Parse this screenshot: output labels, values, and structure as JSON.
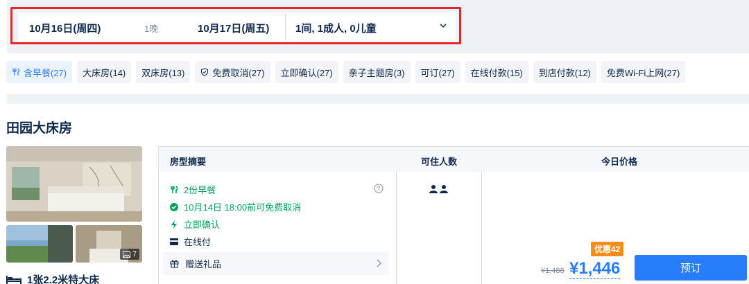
{
  "search": {
    "checkin": "10月16日(周四)",
    "nights": "1晚",
    "checkout": "10月17日(周五)",
    "guests": "1间, 1成人, 0儿童"
  },
  "filters": [
    {
      "label": "含早餐(27)",
      "icon": "utensils-icon",
      "active": true
    },
    {
      "label": "大床房(14)"
    },
    {
      "label": "双床房(13)"
    },
    {
      "label": "免费取消(27)",
      "icon": "shield-check-icon"
    },
    {
      "label": "立即确认(27)"
    },
    {
      "label": "亲子主题房(3)"
    },
    {
      "label": "可订(27)"
    },
    {
      "label": "在线付款(15)"
    },
    {
      "label": "到店付款(12)"
    },
    {
      "label": "免费Wi-Fi上网(27)"
    }
  ],
  "room": {
    "title": "田园大床房",
    "photo_count": "7",
    "bed": "1张2.2米特大床"
  },
  "table": {
    "headers": {
      "summary": "房型摘要",
      "occupancy": "可住人数",
      "price": "今日价格"
    },
    "features": {
      "breakfast": "2份早餐",
      "cancel": "10月14日 18:00前可免费取消",
      "confirm": "立即确认",
      "payment": "在线付",
      "gift": "赠送礼品"
    },
    "promo": "优惠42",
    "original_price": "¥1,488",
    "price": "¥1,446",
    "book_label": "预订"
  },
  "colors": {
    "accent": "#287dfa",
    "promo": "#ff8c1a",
    "highlight": "#e8232b",
    "green": "#00a35a"
  }
}
